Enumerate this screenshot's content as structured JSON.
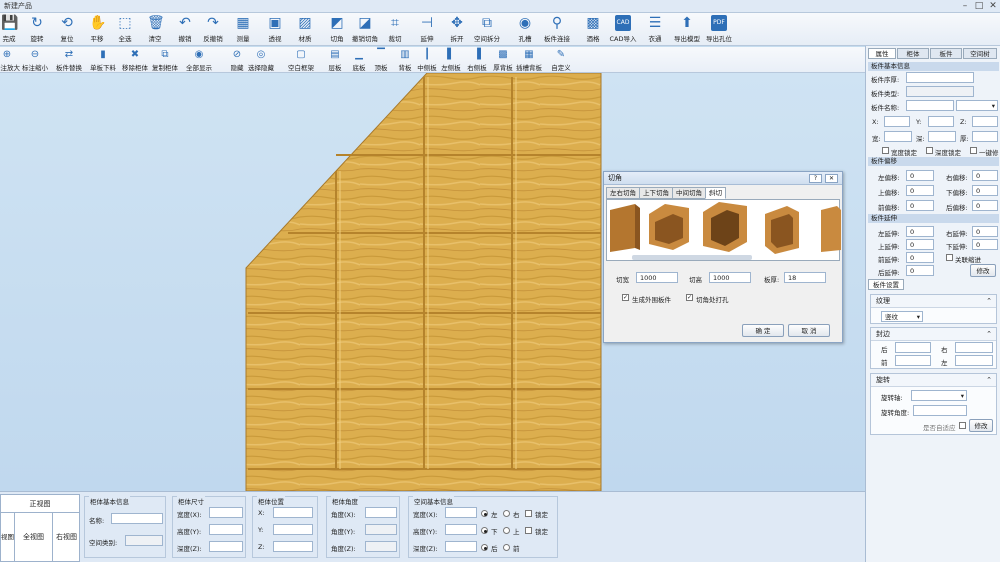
{
  "window": {
    "title": "新建产品"
  },
  "ribbon": [
    {
      "label": "完成",
      "icon": "save-icon"
    },
    {
      "label": "旋转",
      "icon": "rotate-icon"
    },
    {
      "label": "复位",
      "icon": "reset-icon"
    },
    {
      "label": "平移",
      "icon": "hand-icon"
    },
    {
      "label": "全选",
      "icon": "select-all-icon"
    },
    {
      "label": "清空",
      "icon": "trash-icon"
    },
    {
      "label": "撤销",
      "icon": "undo-icon"
    },
    {
      "label": "反撤销",
      "icon": "redo-icon"
    },
    {
      "label": "测量",
      "icon": "measure-icon"
    },
    {
      "label": "透视",
      "icon": "perspective-icon"
    },
    {
      "label": "材质",
      "icon": "material-icon"
    },
    {
      "label": "切角",
      "icon": "cut-corner-icon"
    },
    {
      "label": "撤销切角",
      "icon": "undo-cut-icon"
    },
    {
      "label": "裁切",
      "icon": "crop-icon"
    },
    {
      "label": "延伸",
      "icon": "extend-icon"
    },
    {
      "label": "拆开",
      "icon": "split-icon"
    },
    {
      "label": "空间拆分",
      "icon": "space-split-icon"
    },
    {
      "label": "孔槽",
      "icon": "hole-icon"
    },
    {
      "label": "板件连接",
      "icon": "link-icon"
    },
    {
      "label": "酒格",
      "icon": "wine-rack-icon"
    },
    {
      "label": "CAD导入",
      "icon": "cad-icon"
    },
    {
      "label": "衣通",
      "icon": "hanger-rail-icon"
    },
    {
      "label": "导出模型",
      "icon": "export-model-icon"
    },
    {
      "label": "导出孔位",
      "icon": "pdf-icon"
    }
  ],
  "toolbar2": [
    {
      "label": "标注放大",
      "icon": "zoom-in-icon"
    },
    {
      "label": "标注缩小",
      "icon": "zoom-out-icon"
    },
    {
      "label": "板件替换",
      "icon": "panel-replace-icon"
    },
    {
      "label": "单板下料",
      "icon": "single-panel-icon"
    },
    {
      "label": "移除柜体",
      "icon": "remove-cabinet-icon"
    },
    {
      "label": "复制柜体",
      "icon": "copy-cabinet-icon"
    },
    {
      "label": "全部显示",
      "icon": "eye-icon"
    },
    {
      "label": "隐藏",
      "icon": "eye-hide-icon"
    },
    {
      "label": "选择隐藏",
      "icon": "eye-select-icon"
    },
    {
      "label": "空白框架",
      "icon": "frame-icon"
    },
    {
      "label": "层板",
      "icon": "shelf-icon"
    },
    {
      "label": "底板",
      "icon": "bottom-panel-icon"
    },
    {
      "label": "顶板",
      "icon": "top-panel-icon"
    },
    {
      "label": "背板",
      "icon": "back-panel-icon"
    },
    {
      "label": "中侧板",
      "icon": "middle-side-icon"
    },
    {
      "label": "左侧板",
      "icon": "left-side-icon"
    },
    {
      "label": "右侧板",
      "icon": "right-side-icon"
    },
    {
      "label": "厚背板",
      "icon": "thick-back-icon"
    },
    {
      "label": "插槽背板",
      "icon": "slot-back-icon"
    },
    {
      "label": "自定义",
      "icon": "custom-icon"
    }
  ],
  "dialog": {
    "title": "切角",
    "tabs": [
      "左右切角",
      "上下切角",
      "中间切角",
      "斜切"
    ],
    "cut_width_label": "切宽",
    "cut_width": "1000",
    "cut_height_label": "切高",
    "cut_height": "1000",
    "thickness_label": "板厚:",
    "thickness": "18",
    "gen_panel_label": "生成外围板件",
    "drill_label": "切角处打孔",
    "ok": "确 定",
    "cancel": "取 消"
  },
  "right_panel": {
    "tabs": [
      "属性",
      "柜体",
      "板件",
      "空间树"
    ],
    "basic_header": "板件基本信息",
    "seq_label": "板件序厚:",
    "type_label": "板件类型:",
    "name_label": "板件名称:",
    "x_label": "X:",
    "y_label": "Y:",
    "z_label": "Z:",
    "w_label": "宽:",
    "d_label": "深:",
    "h_label": "厚:",
    "lock_w": "宽度锁定",
    "lock_d": "深度锁定",
    "lock_all": "一键修改",
    "offset_header": "板件偏移",
    "left_off": "左偏移:",
    "right_off": "右偏移:",
    "top_off": "上偏移:",
    "down_off": "下偏移:",
    "front_off": "前偏移:",
    "back_off": "后偏移:",
    "off_values": [
      "0",
      "0",
      "0",
      "0",
      "0",
      "0"
    ],
    "ext_header": "板件延伸",
    "left_ext": "左延伸:",
    "right_ext": "右延伸:",
    "top_ext": "上延伸:",
    "down_ext": "下延伸:",
    "front_ext": "前延伸:",
    "back_ext": "后延伸:",
    "ext_values": [
      "0",
      "0",
      "0",
      "0",
      "0",
      "0"
    ],
    "link_slot": "关联缩进",
    "modify": "修改",
    "settings_header": "板件设置",
    "texture_title": "纹理",
    "texture_value": "竖纹",
    "edge_title": "封边",
    "edge_back": "后",
    "edge_right": "右",
    "edge_front": "前",
    "edge_left": "左",
    "rot_title": "旋转",
    "rot_axis": "旋转轴:",
    "rot_angle": "旋转角度:",
    "auto_fit": "是否自适应",
    "rot_modify": "修改"
  },
  "bottom": {
    "views_header": "正视图",
    "view_left": "视图",
    "view_full": "全视图",
    "view_right": "右视图",
    "cab_info": "柜体基本信息",
    "name_label": "名称:",
    "space_type": "空间类别:",
    "size_title": "柜体尺寸",
    "w": "宽度(X):",
    "h": "高度(Y):",
    "d": "深度(Z):",
    "pos_title": "柜体位置",
    "px": "X:",
    "py": "Y:",
    "pz": "Z:",
    "ang_title": "柜体角度",
    "ax": "角度(X):",
    "ay": "角度(Y):",
    "az": "角度(Z):",
    "space_title": "空间基本信息",
    "sw": "宽度(X):",
    "sh": "高度(Y):",
    "sd": "深度(Z):",
    "left": "左",
    "right": "右",
    "down": "下",
    "up": "上",
    "back": "后",
    "front": "前",
    "lock": "锁定"
  }
}
